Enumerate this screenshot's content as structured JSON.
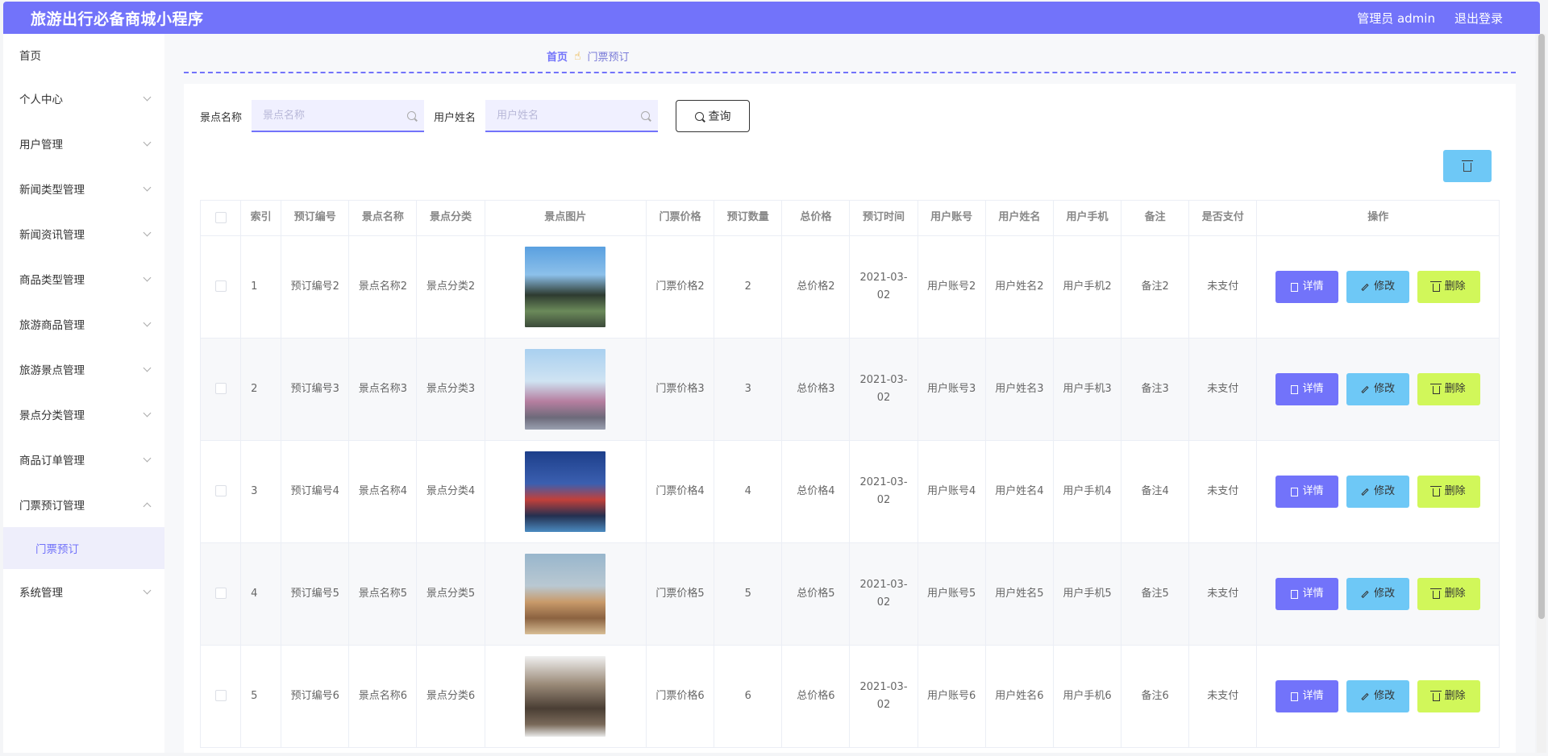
{
  "header": {
    "title": "旅游出行必备商城小程序",
    "user_label": "管理员 admin",
    "logout_label": "退出登录"
  },
  "sidebar": {
    "items": [
      {
        "label": "首页",
        "chevron": false
      },
      {
        "label": "个人中心",
        "chevron": true
      },
      {
        "label": "用户管理",
        "chevron": true
      },
      {
        "label": "新闻类型管理",
        "chevron": true
      },
      {
        "label": "新闻资讯管理",
        "chevron": true
      },
      {
        "label": "商品类型管理",
        "chevron": true
      },
      {
        "label": "旅游商品管理",
        "chevron": true
      },
      {
        "label": "旅游景点管理",
        "chevron": true
      },
      {
        "label": "景点分类管理",
        "chevron": true
      },
      {
        "label": "商品订单管理",
        "chevron": true
      },
      {
        "label": "门票预订管理",
        "chevron": true,
        "expanded": true
      },
      {
        "label": "系统管理",
        "chevron": true
      }
    ],
    "active_sub": "门票预订"
  },
  "breadcrumb": {
    "home": "首页",
    "current": "门票预订"
  },
  "search": {
    "spot_label": "景点名称",
    "spot_placeholder": "景点名称",
    "user_label": "用户姓名",
    "user_placeholder": "用户姓名",
    "query_label": "查询"
  },
  "table": {
    "headers": [
      "索引",
      "预订编号",
      "景点名称",
      "景点分类",
      "景点图片",
      "门票价格",
      "预订数量",
      "总价格",
      "预订时间",
      "用户账号",
      "用户姓名",
      "用户手机",
      "备注",
      "是否支付",
      "操作"
    ],
    "rows": [
      {
        "idx": "1",
        "code": "预订编号2",
        "name": "景点名称2",
        "cat": "景点分类2",
        "price": "门票价格2",
        "qty": "2",
        "total": "总价格2",
        "time": "2021-03-02",
        "acct": "用户账号2",
        "uname": "用户姓名2",
        "phone": "用户手机2",
        "note": "备注2",
        "paid": "未支付",
        "image": "pagoda"
      },
      {
        "idx": "2",
        "code": "预订编号3",
        "name": "景点名称3",
        "cat": "景点分类3",
        "price": "门票价格3",
        "qty": "3",
        "total": "总价格3",
        "time": "2021-03-02",
        "acct": "用户账号3",
        "uname": "用户姓名3",
        "phone": "用户手机3",
        "note": "备注3",
        "paid": "未支付",
        "image": "castle"
      },
      {
        "idx": "3",
        "code": "预订编号4",
        "name": "景点名称4",
        "cat": "景点分类4",
        "price": "门票价格4",
        "qty": "4",
        "total": "总价格4",
        "time": "2021-03-02",
        "acct": "用户账号4",
        "uname": "用户姓名4",
        "phone": "用户手机4",
        "note": "备注4",
        "paid": "未支付",
        "image": "night-town"
      },
      {
        "idx": "4",
        "code": "预订编号5",
        "name": "景点名称5",
        "cat": "景点分类5",
        "price": "门票价格5",
        "qty": "5",
        "total": "总价格5",
        "time": "2021-03-02",
        "acct": "用户账号5",
        "uname": "用户姓名5",
        "phone": "用户手机5",
        "note": "备注5",
        "paid": "未支付",
        "image": "cliff"
      },
      {
        "idx": "5",
        "code": "预订编号6",
        "name": "景点名称6",
        "cat": "景点分类6",
        "price": "门票价格6",
        "qty": "6",
        "total": "总价格6",
        "time": "2021-03-02",
        "acct": "用户账号6",
        "uname": "用户姓名6",
        "phone": "用户手机6",
        "note": "备注6",
        "paid": "未支付",
        "image": "gate"
      }
    ],
    "actions": {
      "detail": "详情",
      "edit": "修改",
      "delete": "删除"
    }
  },
  "colors": {
    "accent": "#7273fa",
    "edit": "#6ec8f6",
    "delete": "#d1f75a"
  }
}
